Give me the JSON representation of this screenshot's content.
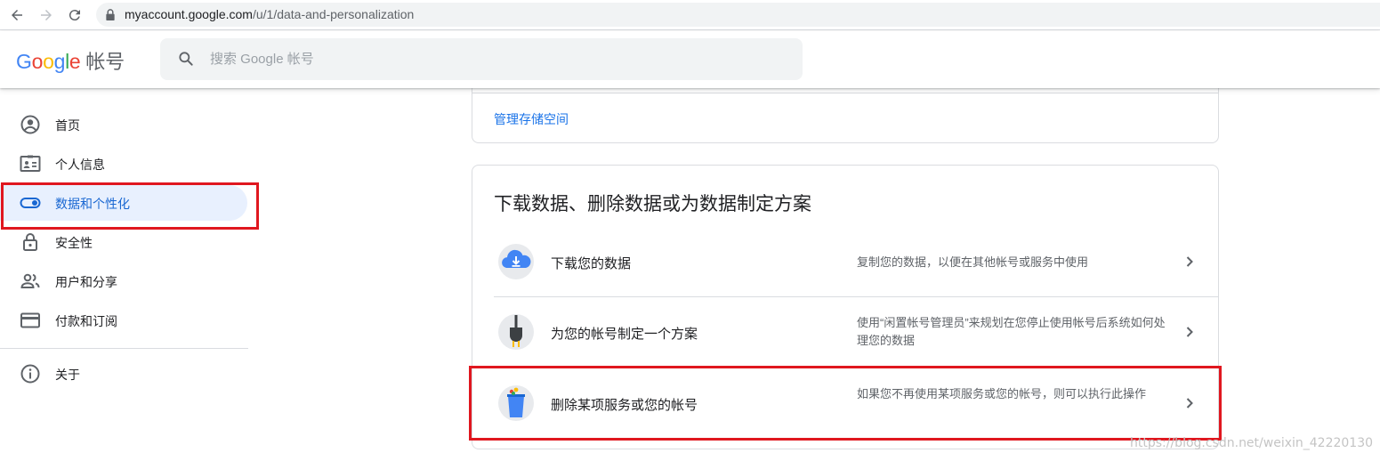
{
  "browser": {
    "url_host": "myaccount.google.com",
    "url_path": "/u/1/data-and-personalization"
  },
  "header": {
    "logo_letters": [
      "G",
      "o",
      "o",
      "g",
      "l",
      "e"
    ],
    "product_name": "帐号",
    "search_placeholder": "搜索 Google 帐号"
  },
  "sidebar": {
    "items": [
      {
        "label": "首页",
        "icon": "account-circle-icon",
        "active": false
      },
      {
        "label": "个人信息",
        "icon": "id-card-icon",
        "active": false
      },
      {
        "label": "数据和个性化",
        "icon": "toggle-icon",
        "active": true
      },
      {
        "label": "安全性",
        "icon": "lock-icon",
        "active": false
      },
      {
        "label": "用户和分享",
        "icon": "people-icon",
        "active": false
      },
      {
        "label": "付款和订阅",
        "icon": "credit-card-icon",
        "active": false
      }
    ],
    "about_label": "关于"
  },
  "storage_card": {
    "link_label": "管理存储空间"
  },
  "download_card": {
    "title": "下载数据、删除数据或为数据制定方案",
    "rows": [
      {
        "title": "下载您的数据",
        "description": "复制您的数据，以便在其他帐号或服务中使用",
        "illustration": "cloud-download-icon"
      },
      {
        "title": "为您的帐号制定一个方案",
        "description": "使用“闲置帐号管理员”来规划在您停止使用帐号后系统如何处理您的数据",
        "illustration": "plug-icon"
      },
      {
        "title": "删除某项服务或您的帐号",
        "description": "如果您不再使用某项服务或您的帐号，则可以执行此操作",
        "illustration": "trash-bin-icon"
      }
    ]
  },
  "watermark": "https://blog.csdn.net/weixin_42220130",
  "colors": {
    "accent_blue": "#1a73e8",
    "active_nav_bg": "#e8f0fe",
    "annotation_red": "#e0171f"
  }
}
